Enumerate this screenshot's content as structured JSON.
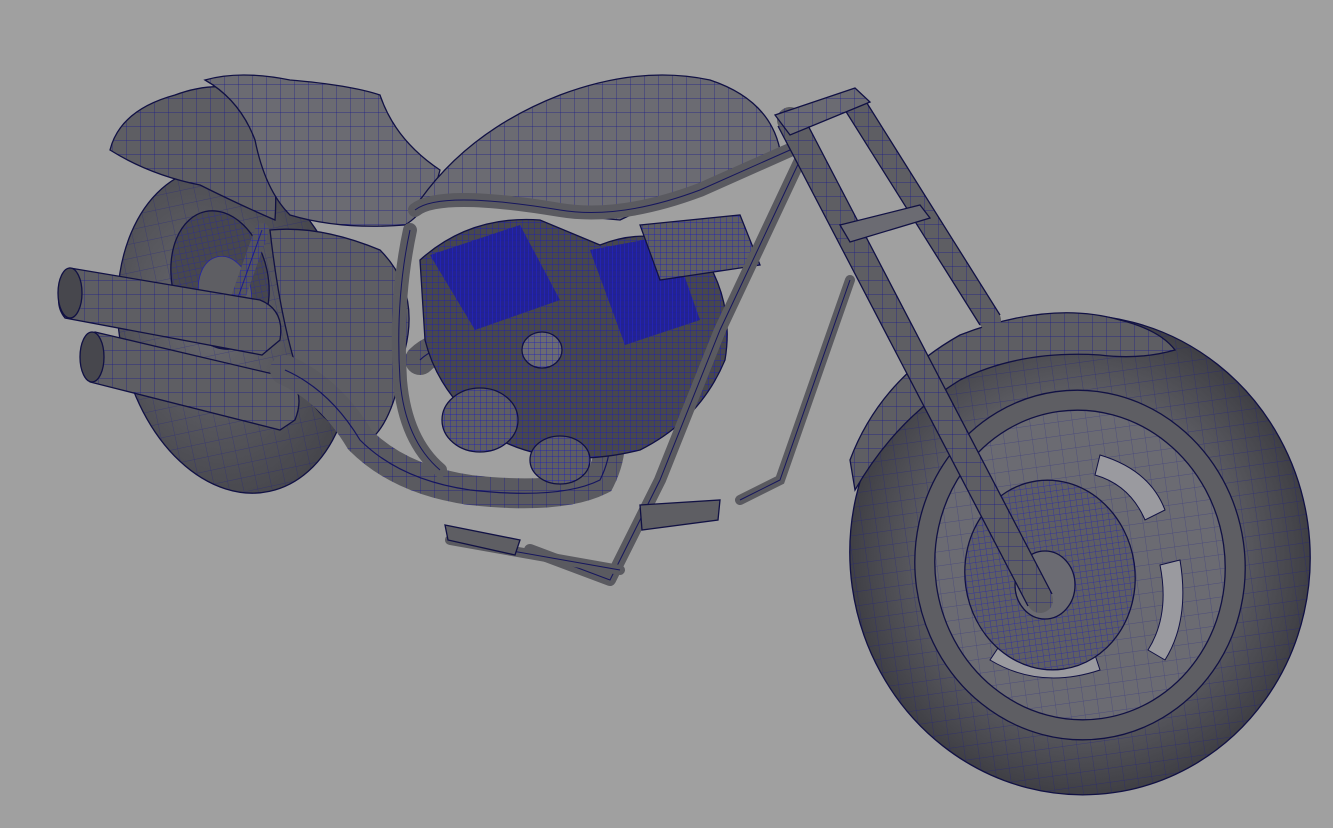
{
  "viewport": {
    "background_color": "#a0a0a0",
    "display_mode": "wireframe-on-shaded"
  },
  "model": {
    "subject": "motorcycle",
    "shaded_color": "#5e5e63",
    "wireframe_color": "#1c1c8a"
  }
}
